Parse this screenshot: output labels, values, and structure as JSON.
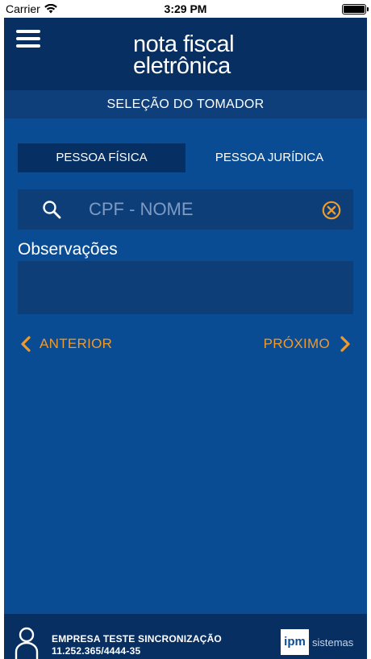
{
  "status_bar": {
    "carrier": "Carrier",
    "time": "3:29 PM"
  },
  "header": {
    "logo_line1": "nota fiscal",
    "logo_line2": "eletrônica"
  },
  "section": {
    "title": "SELEÇÃO DO TOMADOR"
  },
  "tabs": [
    {
      "label": "PESSOA FÍSICA",
      "active": true
    },
    {
      "label": "PESSOA JURÍDICA",
      "active": false
    }
  ],
  "search": {
    "placeholder": "CPF - NOME",
    "value": ""
  },
  "observations": {
    "label": "Observações",
    "value": ""
  },
  "navigation": {
    "previous_label": "ANTERIOR",
    "next_label": "PRÓXIMO"
  },
  "footer": {
    "company_name": "EMPRESA TESTE SINCRONIZAÇÃO",
    "company_id": "11.252.365/4444-35",
    "brand_mark": "ipm",
    "brand_word": "sistemas"
  },
  "colors": {
    "background": "#0a4c94",
    "header": "#082f61",
    "accent": "#ef9a2c"
  },
  "icons": [
    "wifi-icon",
    "battery-icon",
    "menu-icon",
    "search-icon",
    "clear-icon",
    "chevron-left-icon",
    "chevron-right-icon",
    "user-icon",
    "ipm-logo"
  ]
}
